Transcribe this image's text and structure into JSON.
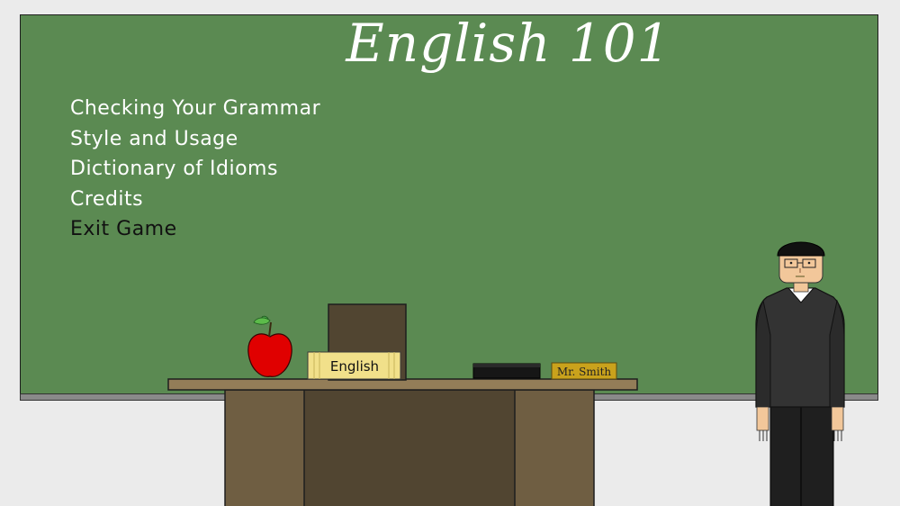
{
  "title": "English 101",
  "menu": [
    {
      "label": "Checking Your Grammar"
    },
    {
      "label": "Style and Usage"
    },
    {
      "label": "Dictionary of Idioms"
    },
    {
      "label": "Credits"
    },
    {
      "label": "Exit Game"
    }
  ],
  "desk": {
    "book_label": "English",
    "nameplate": "Mr. Smith"
  },
  "colors": {
    "chalkboard": "#5b8a52",
    "chalk_text": "#ffffff",
    "desk_top": "#8f7a55",
    "desk_body": "#6c5a40",
    "apple": "#e00000"
  }
}
